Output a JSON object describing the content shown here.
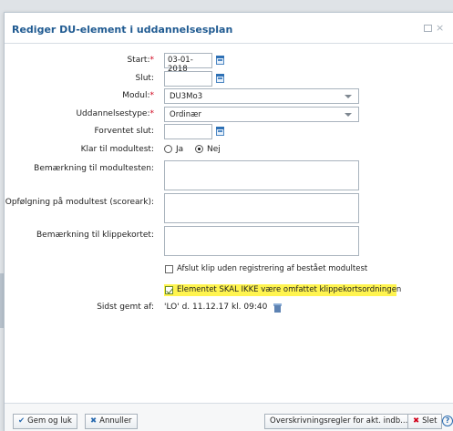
{
  "dialog": {
    "title": "Rediger DU-element i uddannelsesplan",
    "controls": {
      "maximize": "maximize-icon",
      "close": "close-icon"
    }
  },
  "form": {
    "start": {
      "label": "Start:",
      "required": "*",
      "value": "03-01-2018"
    },
    "slut": {
      "label": "Slut:",
      "value": ""
    },
    "modul": {
      "label": "Modul:",
      "required": "*",
      "value": "DU3Mo3"
    },
    "uddannelsestype": {
      "label": "Uddannelsestype:",
      "required": "*",
      "value": "Ordinær"
    },
    "forventet_slut": {
      "label": "Forventet slut:",
      "value": ""
    },
    "klar_til_modultest": {
      "label": "Klar til modultest:",
      "option_ja": "Ja",
      "option_nej": "Nej",
      "selected": "Nej"
    },
    "bemaerkning_modultest": {
      "label": "Bemærkning til modultesten:"
    },
    "opfoelgning": {
      "label": "Opfølgning på modultest (scoreark):"
    },
    "bemaerkning_klippekort": {
      "label": "Bemærkning til klippekortet:"
    },
    "afslut_klip": {
      "label": "Afslut klip uden registrering af bestået modultest",
      "checked": false
    },
    "ikke_omfattet": {
      "label": "Elementet SKAL IKKE være omfattet klippekortsordningen",
      "checked": true
    },
    "sidst_gemt": {
      "label": "Sidst gemt af:",
      "value": "'LO' d. 11.12.17 kl. 09:40"
    }
  },
  "footer": {
    "save_close": "Gem og luk",
    "cancel": "Annuller",
    "overwrite_rules": "Overskrivningsregler for akt. indb...",
    "delete": "Slet",
    "help": "?"
  },
  "colors": {
    "title": "#1f5a91",
    "required": "#d0021b",
    "highlight": "#fff44f"
  }
}
